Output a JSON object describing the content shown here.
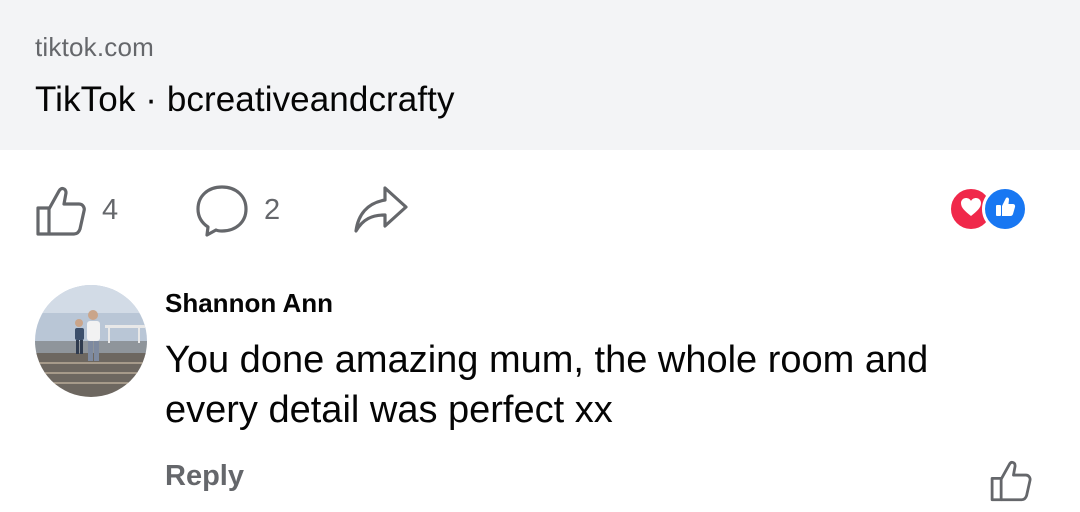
{
  "link_preview": {
    "domain": "tiktok.com",
    "title": "TikTok · bcreativeandcrafty"
  },
  "actions": {
    "like_count": "4",
    "comment_count": "2",
    "like_icon": "thumbs-up-outline-icon",
    "comment_icon": "speech-bubble-icon",
    "share_icon": "share-arrow-icon"
  },
  "reactions": [
    {
      "type": "love",
      "icon": "heart-icon",
      "color": "#f0284a"
    },
    {
      "type": "like",
      "icon": "thumbs-up-icon",
      "color": "#1877f2"
    }
  ],
  "comment": {
    "author": "Shannon Ann",
    "text": "You done amazing mum, the whole room and every detail was perfect xx",
    "reply_label": "Reply",
    "like_icon": "thumbs-up-outline-icon"
  },
  "colors": {
    "card_bg": "#f3f4f6",
    "secondary_text": "#65676b",
    "primary_text": "#050505"
  }
}
